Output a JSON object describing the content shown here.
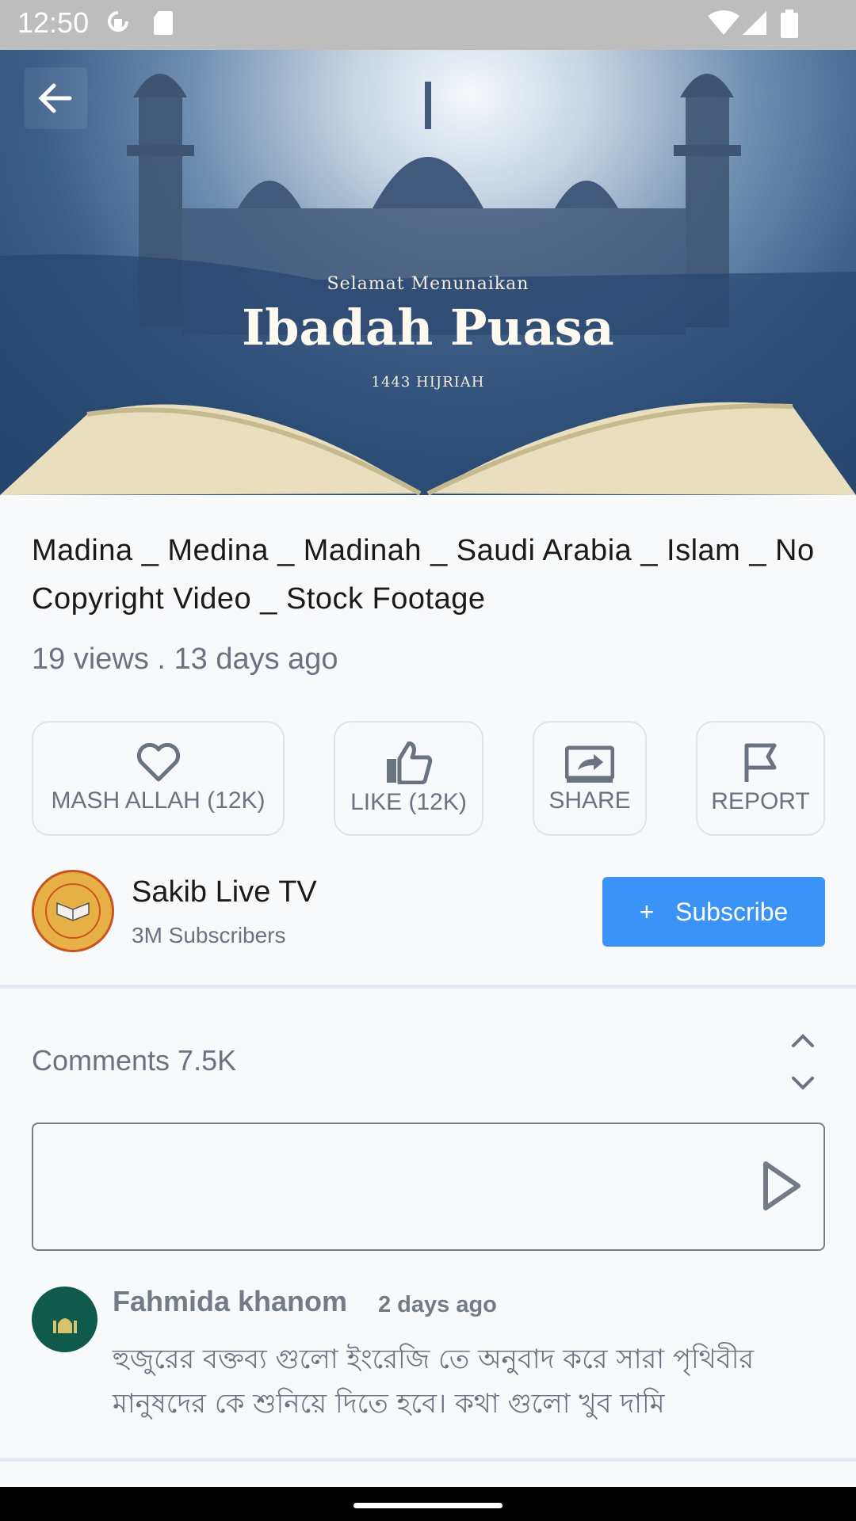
{
  "status_bar": {
    "time": "12:50"
  },
  "hero": {
    "subtitle": "Selamat Menunaikan",
    "title": "Ibadah Puasa",
    "year": "1443 HIJRIAH"
  },
  "video": {
    "title": "Madina _ Medina _ Madinah _ Saudi Arabia _ Islam _ No Copyright Video _ Stock Footage",
    "meta": "19 views . 13 days ago"
  },
  "actions": [
    {
      "label": "MASH ALLAH (12K)",
      "icon": "heart-icon"
    },
    {
      "label": "LIKE (12K)",
      "icon": "thumbs-up-icon"
    },
    {
      "label": "SHARE",
      "icon": "share-icon"
    },
    {
      "label": "REPORT",
      "icon": "flag-icon"
    }
  ],
  "channel": {
    "name": "Sakib Live TV",
    "subscribers": "3M Subscribers",
    "subscribe_label": "+   Subscribe"
  },
  "comments": {
    "label": "Comments 7.5K",
    "input_placeholder": "",
    "items": [
      {
        "author": "Fahmida khanom",
        "time": "2 days ago",
        "text": "হুজুরের বক্তব্য গুলো ইংরেজি তে অনুবাদ করে সারা পৃথিবীর মানুষদের কে শুনিয়ে দিতে হবে। কথা গুলো খুব দামি"
      }
    ]
  },
  "colors": {
    "accent": "#3b93f7",
    "text_primary": "#1a1a1a",
    "text_secondary": "#6b7280",
    "background": "#f8f9fb",
    "status_bar": "#bdbdbd"
  }
}
